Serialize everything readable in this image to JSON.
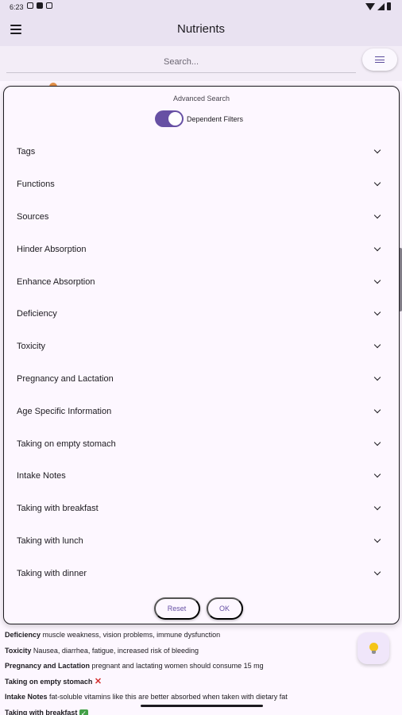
{
  "status_bar": {
    "time": "6:23"
  },
  "app_bar": {
    "title": "Nutrients"
  },
  "search": {
    "placeholder": "Search..."
  },
  "dialog": {
    "title": "Advanced Search",
    "toggle_label": "Dependent Filters",
    "toggle_on": true,
    "filters": [
      {
        "label": "Tags"
      },
      {
        "label": "Functions"
      },
      {
        "label": "Sources"
      },
      {
        "label": "Hinder Absorption"
      },
      {
        "label": "Enhance Absorption"
      },
      {
        "label": "Deficiency"
      },
      {
        "label": "Toxicity"
      },
      {
        "label": "Pregnancy and Lactation"
      },
      {
        "label": "Age Specific Information"
      },
      {
        "label": "Taking on empty stomach"
      },
      {
        "label": "Intake Notes"
      },
      {
        "label": "Taking with breakfast"
      },
      {
        "label": "Taking with lunch"
      },
      {
        "label": "Taking with dinner"
      }
    ],
    "reset_label": "Reset",
    "ok_label": "OK"
  },
  "background": {
    "lines": [
      {
        "key": "Deficiency",
        "value": "muscle weakness, vision problems, immune dysfunction"
      },
      {
        "key": "Toxicity",
        "value": "Nausea, diarrhea, fatigue, increased risk of bleeding"
      },
      {
        "key": "Pregnancy and Lactation",
        "value": "pregnant and lactating women should consume 15 mg"
      },
      {
        "key": "Taking on empty stomach",
        "value": ""
      },
      {
        "key": "Intake Notes",
        "value": "fat-soluble vitamins like this are better absorbed when taken with dietary fat"
      },
      {
        "key": "Taking with breakfast",
        "value": ""
      }
    ]
  },
  "colors": {
    "accent": "#6750a4",
    "app_bar": "#e9e2f1",
    "surface": "#fdf7ff"
  }
}
